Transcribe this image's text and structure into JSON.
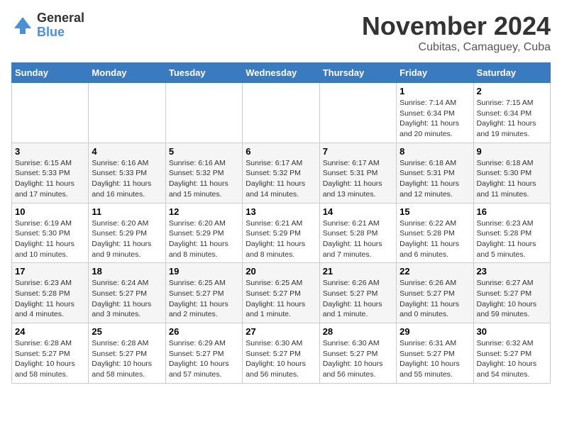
{
  "logo": {
    "general": "General",
    "blue": "Blue"
  },
  "title": {
    "month": "November 2024",
    "location": "Cubitas, Camaguey, Cuba"
  },
  "weekdays": [
    "Sunday",
    "Monday",
    "Tuesday",
    "Wednesday",
    "Thursday",
    "Friday",
    "Saturday"
  ],
  "weeks": [
    [
      {
        "day": "",
        "info": ""
      },
      {
        "day": "",
        "info": ""
      },
      {
        "day": "",
        "info": ""
      },
      {
        "day": "",
        "info": ""
      },
      {
        "day": "",
        "info": ""
      },
      {
        "day": "1",
        "info": "Sunrise: 7:14 AM\nSunset: 6:34 PM\nDaylight: 11 hours\nand 20 minutes."
      },
      {
        "day": "2",
        "info": "Sunrise: 7:15 AM\nSunset: 6:34 PM\nDaylight: 11 hours\nand 19 minutes."
      }
    ],
    [
      {
        "day": "3",
        "info": "Sunrise: 6:15 AM\nSunset: 5:33 PM\nDaylight: 11 hours\nand 17 minutes."
      },
      {
        "day": "4",
        "info": "Sunrise: 6:16 AM\nSunset: 5:33 PM\nDaylight: 11 hours\nand 16 minutes."
      },
      {
        "day": "5",
        "info": "Sunrise: 6:16 AM\nSunset: 5:32 PM\nDaylight: 11 hours\nand 15 minutes."
      },
      {
        "day": "6",
        "info": "Sunrise: 6:17 AM\nSunset: 5:32 PM\nDaylight: 11 hours\nand 14 minutes."
      },
      {
        "day": "7",
        "info": "Sunrise: 6:17 AM\nSunset: 5:31 PM\nDaylight: 11 hours\nand 13 minutes."
      },
      {
        "day": "8",
        "info": "Sunrise: 6:18 AM\nSunset: 5:31 PM\nDaylight: 11 hours\nand 12 minutes."
      },
      {
        "day": "9",
        "info": "Sunrise: 6:18 AM\nSunset: 5:30 PM\nDaylight: 11 hours\nand 11 minutes."
      }
    ],
    [
      {
        "day": "10",
        "info": "Sunrise: 6:19 AM\nSunset: 5:30 PM\nDaylight: 11 hours\nand 10 minutes."
      },
      {
        "day": "11",
        "info": "Sunrise: 6:20 AM\nSunset: 5:29 PM\nDaylight: 11 hours\nand 9 minutes."
      },
      {
        "day": "12",
        "info": "Sunrise: 6:20 AM\nSunset: 5:29 PM\nDaylight: 11 hours\nand 8 minutes."
      },
      {
        "day": "13",
        "info": "Sunrise: 6:21 AM\nSunset: 5:29 PM\nDaylight: 11 hours\nand 8 minutes."
      },
      {
        "day": "14",
        "info": "Sunrise: 6:21 AM\nSunset: 5:28 PM\nDaylight: 11 hours\nand 7 minutes."
      },
      {
        "day": "15",
        "info": "Sunrise: 6:22 AM\nSunset: 5:28 PM\nDaylight: 11 hours\nand 6 minutes."
      },
      {
        "day": "16",
        "info": "Sunrise: 6:23 AM\nSunset: 5:28 PM\nDaylight: 11 hours\nand 5 minutes."
      }
    ],
    [
      {
        "day": "17",
        "info": "Sunrise: 6:23 AM\nSunset: 5:28 PM\nDaylight: 11 hours\nand 4 minutes."
      },
      {
        "day": "18",
        "info": "Sunrise: 6:24 AM\nSunset: 5:27 PM\nDaylight: 11 hours\nand 3 minutes."
      },
      {
        "day": "19",
        "info": "Sunrise: 6:25 AM\nSunset: 5:27 PM\nDaylight: 11 hours\nand 2 minutes."
      },
      {
        "day": "20",
        "info": "Sunrise: 6:25 AM\nSunset: 5:27 PM\nDaylight: 11 hours\nand 1 minute."
      },
      {
        "day": "21",
        "info": "Sunrise: 6:26 AM\nSunset: 5:27 PM\nDaylight: 11 hours\nand 1 minute."
      },
      {
        "day": "22",
        "info": "Sunrise: 6:26 AM\nSunset: 5:27 PM\nDaylight: 11 hours\nand 0 minutes."
      },
      {
        "day": "23",
        "info": "Sunrise: 6:27 AM\nSunset: 5:27 PM\nDaylight: 10 hours\nand 59 minutes."
      }
    ],
    [
      {
        "day": "24",
        "info": "Sunrise: 6:28 AM\nSunset: 5:27 PM\nDaylight: 10 hours\nand 58 minutes."
      },
      {
        "day": "25",
        "info": "Sunrise: 6:28 AM\nSunset: 5:27 PM\nDaylight: 10 hours\nand 58 minutes."
      },
      {
        "day": "26",
        "info": "Sunrise: 6:29 AM\nSunset: 5:27 PM\nDaylight: 10 hours\nand 57 minutes."
      },
      {
        "day": "27",
        "info": "Sunrise: 6:30 AM\nSunset: 5:27 PM\nDaylight: 10 hours\nand 56 minutes."
      },
      {
        "day": "28",
        "info": "Sunrise: 6:30 AM\nSunset: 5:27 PM\nDaylight: 10 hours\nand 56 minutes."
      },
      {
        "day": "29",
        "info": "Sunrise: 6:31 AM\nSunset: 5:27 PM\nDaylight: 10 hours\nand 55 minutes."
      },
      {
        "day": "30",
        "info": "Sunrise: 6:32 AM\nSunset: 5:27 PM\nDaylight: 10 hours\nand 54 minutes."
      }
    ]
  ]
}
